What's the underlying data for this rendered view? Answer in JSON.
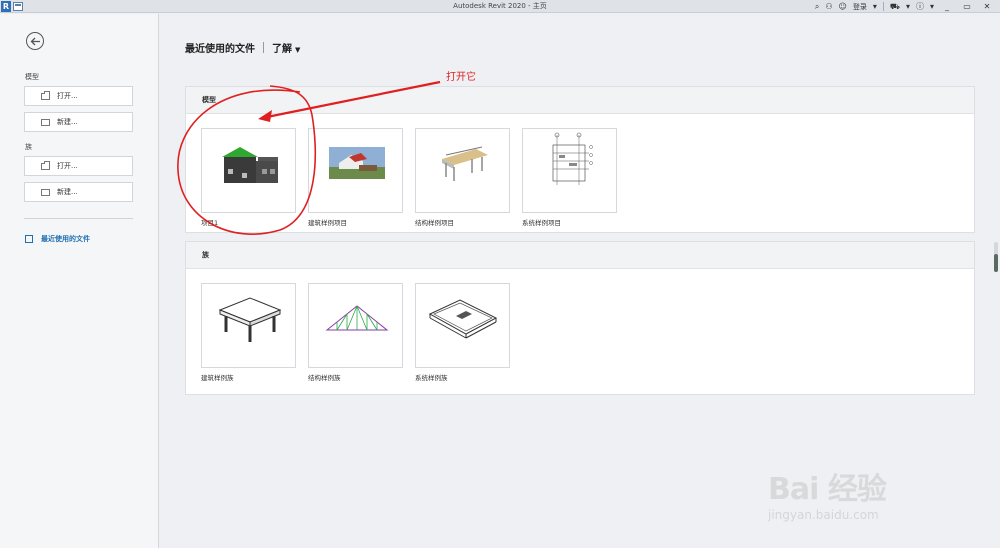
{
  "titlebar": {
    "logo": "R",
    "title": "Autodesk Revit 2020 - 主页",
    "signin_label": "登录",
    "icons": [
      "search-icon",
      "user-icon",
      "cart-icon",
      "help-icon"
    ],
    "window_controls": [
      "_",
      "▭",
      "✕"
    ]
  },
  "sidebar": {
    "section_model": "模型",
    "model_open": "打开...",
    "model_new": "新建...",
    "section_family": "族",
    "family_open": "打开...",
    "family_new": "新建...",
    "recent_files": "最近使用的文件"
  },
  "header": {
    "title": "最近使用的文件",
    "learn_menu": "了解"
  },
  "models": {
    "heading": "模型",
    "items": [
      {
        "caption": "项目1",
        "thumb": "house-green-roof"
      },
      {
        "caption": "建筑样例项目",
        "thumb": "architecture-render"
      },
      {
        "caption": "结构样例项目",
        "thumb": "structure-frame"
      },
      {
        "caption": "系统样例项目",
        "thumb": "systems-section"
      }
    ]
  },
  "families": {
    "heading": "族",
    "items": [
      {
        "caption": "建筑样例族",
        "thumb": "table"
      },
      {
        "caption": "结构样例族",
        "thumb": "truss"
      },
      {
        "caption": "系统样例族",
        "thumb": "tray"
      }
    ]
  },
  "annotation": {
    "text": "打开它",
    "color": "#e02020"
  },
  "watermark": {
    "main": "Bai 经验",
    "sub": "jingyan.baidu.com"
  }
}
